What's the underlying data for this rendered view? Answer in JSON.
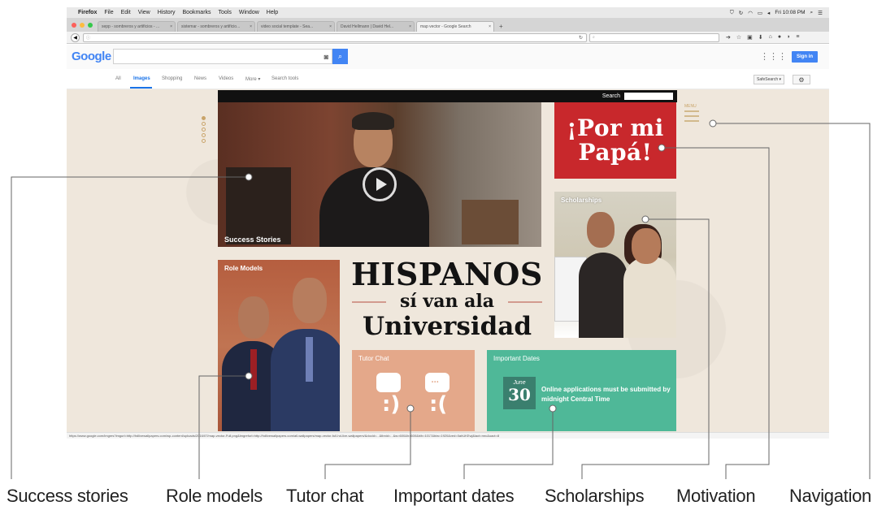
{
  "mac_menu": {
    "app": "Firefox",
    "items": [
      "File",
      "Edit",
      "View",
      "History",
      "Bookmarks",
      "Tools",
      "Window",
      "Help"
    ],
    "clock": "Fri 10:08 PM"
  },
  "browser": {
    "tabs": [
      {
        "title": "sepp - sombreros y artificios - ...",
        "active": false
      },
      {
        "title": "sistemar - sombreros y artificio...",
        "active": false
      },
      {
        "title": "video social template - Sea...",
        "active": false
      },
      {
        "title": "David Hellmann | David Hel...",
        "active": false
      },
      {
        "title": "map vector - Google Search",
        "active": true
      }
    ],
    "url": "",
    "search_placeholder": "",
    "status_url": "https://www.google.com/imgres?imgurl=http://hdlivewallpapers.com/wp-content/uploads/2016/07/map-vector-Full.png&imgrefurl=http://hdlivewallpapers.com/all-wallpapers/map-vector-full-hd-live-wallpapers/&docid=...&tbnid=...&w=600&h=600&bih=1017&biw=1920&ved=0ahUKEwj&iact=mrc&uact=8"
  },
  "google": {
    "logo": "Google",
    "sign_in": "Sign in",
    "nav": [
      "All",
      "Images",
      "Shopping",
      "News",
      "Videos",
      "More ▾",
      "Search tools"
    ],
    "active_nav": "Images",
    "safesearch": "SafeSearch ▾"
  },
  "site": {
    "search_label": "Search",
    "menu_label": "MENU",
    "hero_caption": "Success Stories",
    "papa_line1": "¡Por mi",
    "papa_line2": "Papá!",
    "scholarships_label": "Scholarships",
    "role_models_label": "Role Models",
    "title_line1": "HISPANOS",
    "title_line2": "sí van ala",
    "title_line3": "Universidad",
    "tutor_label": "Tutor Chat",
    "dates_label": "Important Dates",
    "cal_month": "June",
    "cal_day": "30",
    "dates_message": "Online applications must be submitted by midnight Central Time"
  },
  "callouts": {
    "success_stories": "Success stories",
    "role_models": "Role models",
    "tutor_chat": "Tutor chat",
    "important_dates": "Important dates",
    "scholarships": "Scholarships",
    "motivation": "Motivation",
    "navigation": "Navigation"
  },
  "colors": {
    "papa_red": "#c8282c",
    "tutor_peach": "#e4a88a",
    "dates_green": "#4fb898",
    "google_blue": "#4285f4"
  }
}
